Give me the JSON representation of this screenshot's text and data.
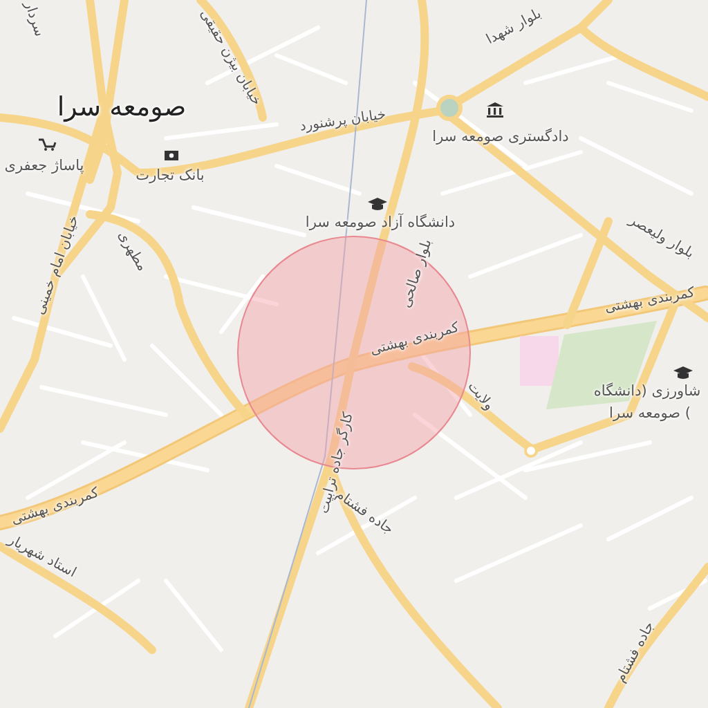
{
  "map": {
    "labels": [
      {
        "text": "صومعه سرا",
        "kind": "city"
      },
      {
        "text": "پاساژ جعفری",
        "kind": "poi"
      },
      {
        "text": "بانک تجارت",
        "kind": "poi"
      },
      {
        "text": "خیابان پرشنورد",
        "kind": "street"
      },
      {
        "text": "بلوار شهدا",
        "kind": "street"
      },
      {
        "text": "دادگستری صومعه سرا",
        "kind": "poi"
      },
      {
        "text": "دانشگاه آزاد صومعه سرا",
        "kind": "poi"
      },
      {
        "text": "بلوار ولیعصر",
        "kind": "street"
      },
      {
        "text": "بلوار صالحی",
        "kind": "street"
      },
      {
        "text": "کمربندی بهشتی",
        "kind": "street"
      },
      {
        "text": "کمربندی بهشتی",
        "kind": "street"
      },
      {
        "text": "کمربندی بهشتی",
        "kind": "street"
      },
      {
        "text": "ولایت",
        "kind": "street"
      },
      {
        "text": "شاورزی (دانشگاه",
        "kind": "poi"
      },
      {
        "text": ") صومعه سرا",
        "kind": "poi"
      },
      {
        "text": "جاده فشتام",
        "kind": "street"
      },
      {
        "text": "جاده فشتام",
        "kind": "street"
      },
      {
        "text": "کارگر جاده ترابیت",
        "kind": "street"
      },
      {
        "text": "خیابان امام خمینی",
        "kind": "street"
      },
      {
        "text": "مطهری",
        "kind": "street"
      },
      {
        "text": "استاد شهریار",
        "kind": "street"
      },
      {
        "text": "خیابان بیژن حقیقی",
        "kind": "street"
      },
      {
        "text": "سردار",
        "kind": "street"
      }
    ]
  }
}
